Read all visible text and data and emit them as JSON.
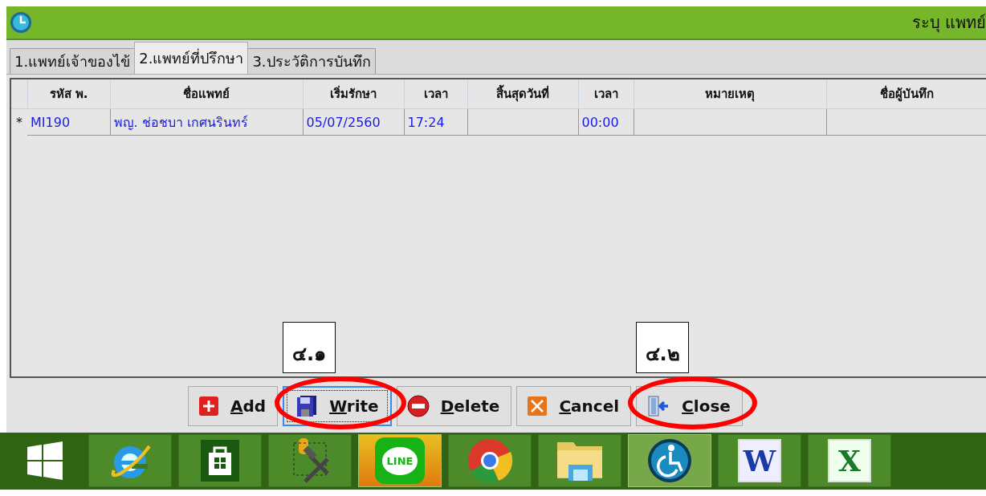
{
  "window": {
    "title": "ระบุ แพทย์"
  },
  "tabs": [
    {
      "label": "1.แพทย์เจ้าของไข้",
      "selected": false
    },
    {
      "label": "2.แพทย์ที่ปรึกษา",
      "selected": true
    },
    {
      "label": "3.ประวัติการบันทึก",
      "selected": false
    }
  ],
  "table": {
    "columns": [
      "รหัส พ.",
      "ชื่อแพทย์",
      "เริ่มรักษา",
      "เวลา",
      "สิ้นสุดวันที่",
      "เวลา",
      "หมายเหตุ",
      "ชื่อผู้บันทึก"
    ],
    "rows": [
      {
        "marker": "*",
        "cells": [
          "MI190",
          "พญ. ช่อชบา เกศนรินทร์",
          "05/07/2560",
          "17:24",
          "",
          "00:00",
          "",
          ""
        ]
      }
    ]
  },
  "buttons": [
    {
      "kind": "add",
      "label": "Add",
      "focused": false
    },
    {
      "kind": "write",
      "label": "Write",
      "focused": true,
      "annotation": "๔.๑"
    },
    {
      "kind": "delete",
      "label": "Delete",
      "focused": false
    },
    {
      "kind": "cancel",
      "label": "Cancel",
      "focused": false
    },
    {
      "kind": "close",
      "label": "Close",
      "focused": false,
      "annotation": "๔.๒"
    }
  ],
  "taskbar": [
    {
      "kind": "start"
    },
    {
      "kind": "ie",
      "active": false
    },
    {
      "kind": "store",
      "active": false
    },
    {
      "kind": "tools",
      "active": false
    },
    {
      "kind": "line",
      "label": "LINE",
      "active": true
    },
    {
      "kind": "chrome",
      "active": false
    },
    {
      "kind": "folder",
      "active": false
    },
    {
      "kind": "access",
      "active": true
    },
    {
      "kind": "word",
      "label": "W",
      "active": false
    },
    {
      "kind": "excel",
      "label": "X",
      "active": false
    }
  ]
}
